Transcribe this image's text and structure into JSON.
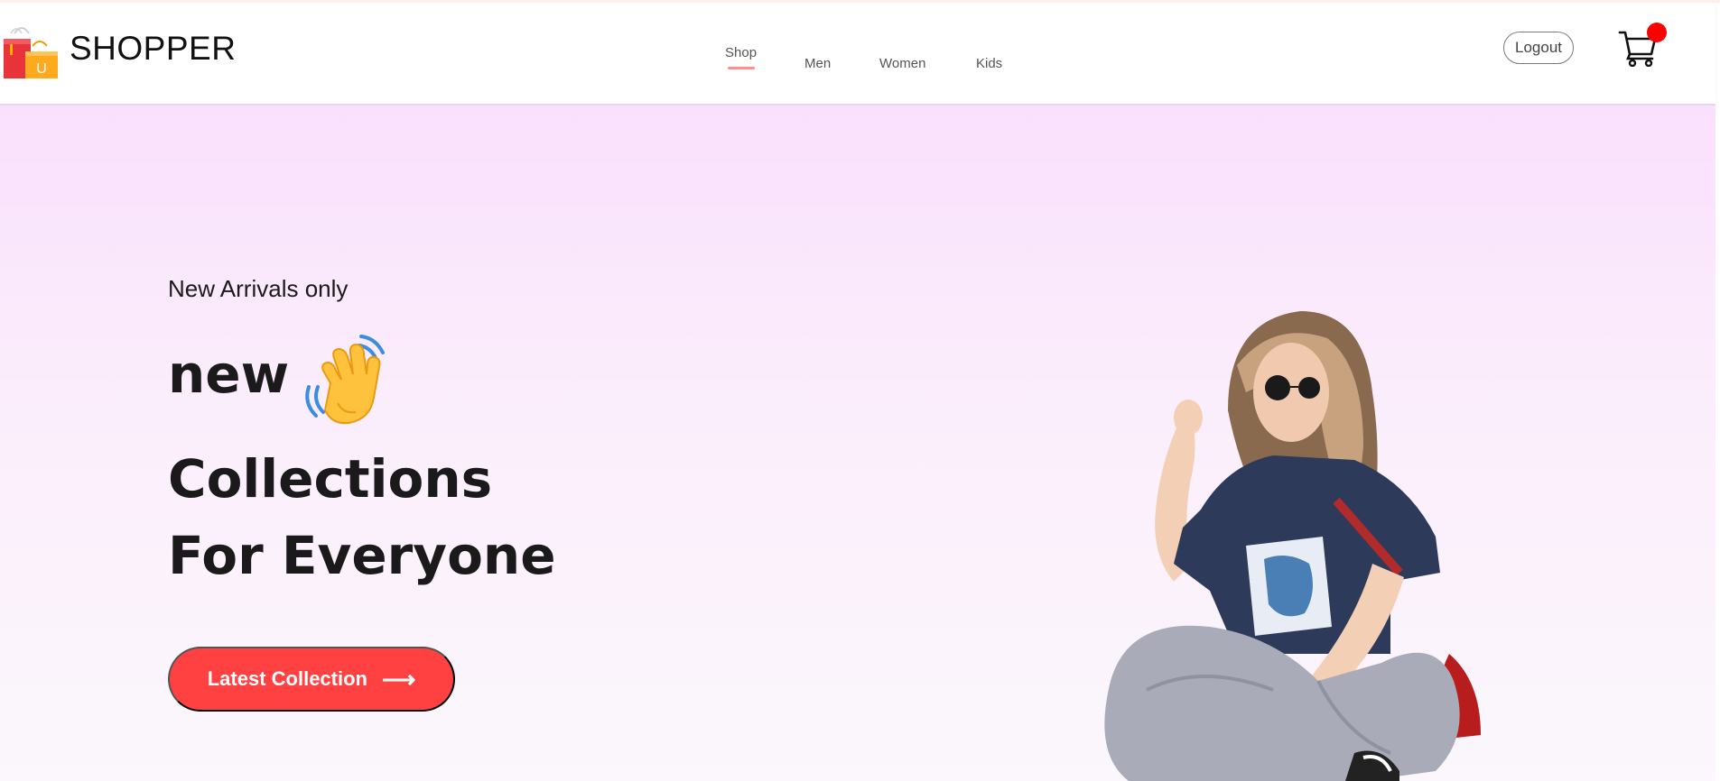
{
  "header": {
    "brand": "SHOPPER",
    "logo_icon": "shopping-bag-icon",
    "nav": [
      {
        "label": "Shop",
        "active": true
      },
      {
        "label": "Men",
        "active": false
      },
      {
        "label": "Women",
        "active": false
      },
      {
        "label": "Kids",
        "active": false
      }
    ],
    "logout_label": "Logout",
    "cart_icon": "cart-icon",
    "accent": "#ff4141",
    "badge_color": "#ff0000"
  },
  "hero": {
    "kicker": "New Arrivals only",
    "line1": "new",
    "line2": "Collections",
    "line3": "For Everyone",
    "wave_icon": "waving-hand-icon",
    "cta_label": "Latest Collection",
    "cta_icon": "arrow-right-icon",
    "gradient_top": "#fae0fd",
    "gradient_bottom": "#fbf7fc"
  }
}
